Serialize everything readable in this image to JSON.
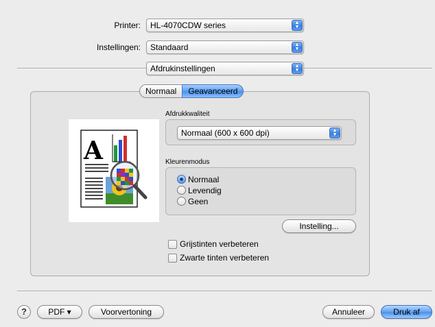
{
  "printer": {
    "label": "Printer:",
    "value": "HL-4070CDW series"
  },
  "settings": {
    "label": "Instellingen:",
    "value": "Standaard"
  },
  "pane": {
    "value": "Afdrukinstellingen"
  },
  "tabs": [
    {
      "label": "Normaal",
      "active": false
    },
    {
      "label": "Geavanceerd",
      "active": true
    }
  ],
  "print_quality": {
    "label": "Afdrukkwaliteit",
    "value": "Normaal (600 x 600 dpi)"
  },
  "color_mode": {
    "label": "Kleurenmodus",
    "options": [
      {
        "label": "Normaal",
        "selected": true
      },
      {
        "label": "Levendig",
        "selected": false
      },
      {
        "label": "Geen",
        "selected": false
      }
    ],
    "settings_button": "Instelling..."
  },
  "checkboxes": [
    {
      "label": "Grijstinten verbeteren",
      "checked": false
    },
    {
      "label": "Zwarte tinten verbeteren",
      "checked": false
    }
  ],
  "footer": {
    "help": "?",
    "pdf": "PDF ▾",
    "preview": "Voorvertoning",
    "cancel": "Annuleer",
    "print": "Druk af"
  },
  "preview_image": {
    "letter": "A",
    "icon": "print-quality-preview-icon"
  },
  "colors": {
    "accent": "#4a8fe9",
    "window_bg": "#ececec"
  }
}
